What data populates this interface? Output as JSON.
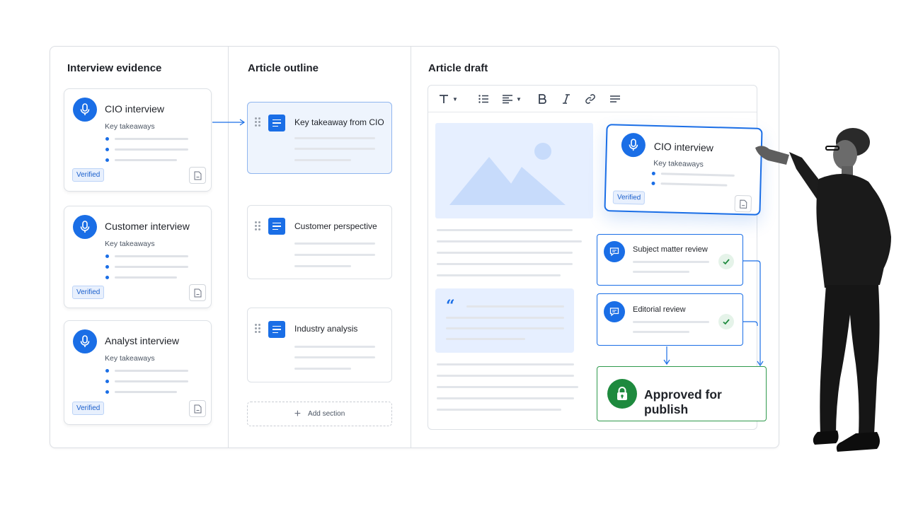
{
  "columns": {
    "evidence_title": "Interview evidence",
    "outline_title": "Article outline",
    "draft_title": "Article draft"
  },
  "evidence_cards": [
    {
      "title": "CIO interview",
      "subtitle": "Key takeaways",
      "badge": "Verified"
    },
    {
      "title": "Customer interview",
      "subtitle": "Key takeaways",
      "badge": "Verified"
    },
    {
      "title": "Analyst interview",
      "subtitle": "Key takeaways",
      "badge": "Verified"
    }
  ],
  "outline_sections": [
    {
      "title": "Key takeaway from CIO",
      "active": true
    },
    {
      "title": "Customer perspective",
      "active": false
    },
    {
      "title": "Industry analysis",
      "active": false
    }
  ],
  "add_section_label": "Add section",
  "toolbar": {
    "icons": [
      "text-style-icon",
      "bullet-list-icon",
      "align-icon",
      "bold-icon",
      "italic-icon",
      "link-icon",
      "paragraph-icon"
    ]
  },
  "draft": {
    "floating_card": {
      "title": "CIO interview",
      "subtitle": "Key takeaways",
      "badge": "Verified"
    },
    "quote_glyph": "“",
    "reviews": [
      {
        "title": "Subject matter review",
        "status": "approved"
      },
      {
        "title": "Editorial review",
        "status": "approved"
      }
    ],
    "approved_label": "Approved for publish"
  },
  "colors": {
    "accent": "#1a6ee6",
    "success": "#1e8a3e",
    "placeholder_fill": "#e6efff"
  }
}
